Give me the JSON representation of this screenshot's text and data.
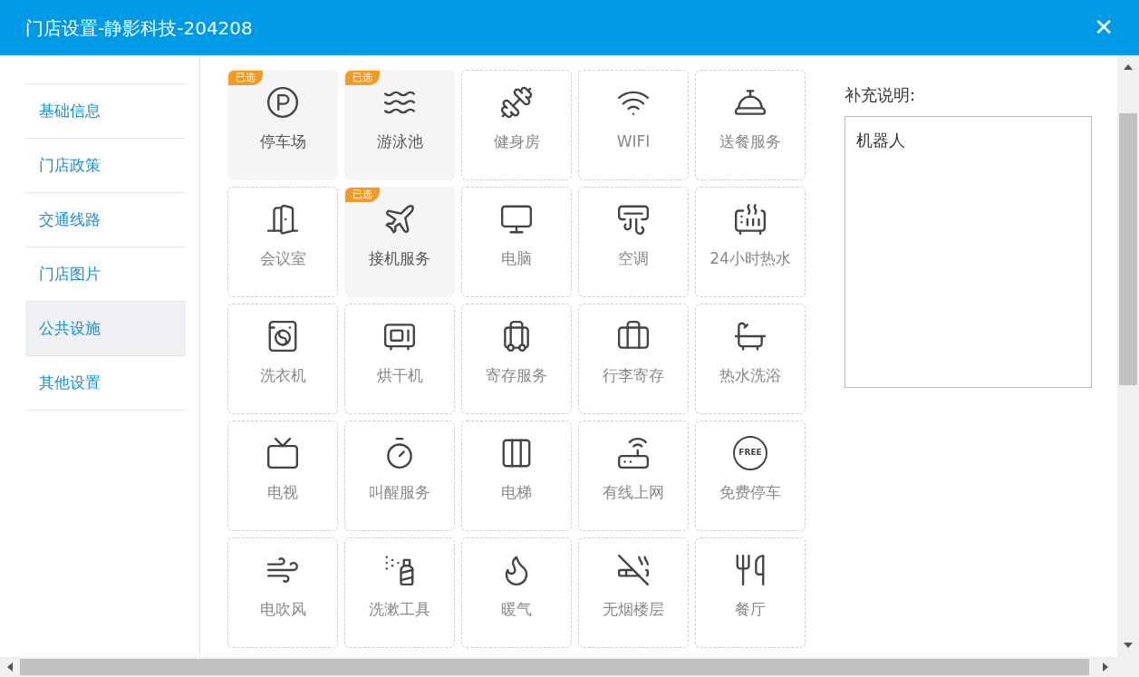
{
  "window": {
    "title": "门店设置-静影科技-204208",
    "close": "✕"
  },
  "sidebar": {
    "items": [
      {
        "label": "基础信息",
        "selected": false
      },
      {
        "label": "门店政策",
        "selected": false
      },
      {
        "label": "交通线路",
        "selected": false
      },
      {
        "label": "门店图片",
        "selected": false
      },
      {
        "label": "公共设施",
        "selected": true
      },
      {
        "label": "其他设置",
        "selected": false
      }
    ]
  },
  "facilities": [
    {
      "label": "停车场",
      "selected": true,
      "badge": "已选"
    },
    {
      "label": "游泳池",
      "selected": true,
      "badge": "已选"
    },
    {
      "label": "健身房",
      "selected": false
    },
    {
      "label": "WIFI",
      "selected": false
    },
    {
      "label": "送餐服务",
      "selected": false
    },
    {
      "label": "会议室",
      "selected": false
    },
    {
      "label": "接机服务",
      "selected": true,
      "badge": "已选"
    },
    {
      "label": "电脑",
      "selected": false
    },
    {
      "label": "空调",
      "selected": false
    },
    {
      "label": "24小时热水",
      "selected": false
    },
    {
      "label": "洗衣机",
      "selected": false
    },
    {
      "label": "烘干机",
      "selected": false
    },
    {
      "label": "寄存服务",
      "selected": false
    },
    {
      "label": "行李寄存",
      "selected": false
    },
    {
      "label": "热水洗浴",
      "selected": false
    },
    {
      "label": "电视",
      "selected": false
    },
    {
      "label": "叫醒服务",
      "selected": false
    },
    {
      "label": "电梯",
      "selected": false
    },
    {
      "label": "有线上网",
      "selected": false
    },
    {
      "label": "免费停车",
      "selected": false,
      "icon_text": "FREE"
    },
    {
      "label": "电吹风",
      "selected": false
    },
    {
      "label": "洗漱工具",
      "selected": false
    },
    {
      "label": "暖气",
      "selected": false
    },
    {
      "label": "无烟楼层",
      "selected": false
    },
    {
      "label": "餐厅",
      "selected": false
    }
  ],
  "notes": {
    "label": "补充说明:",
    "value": "机器人"
  }
}
